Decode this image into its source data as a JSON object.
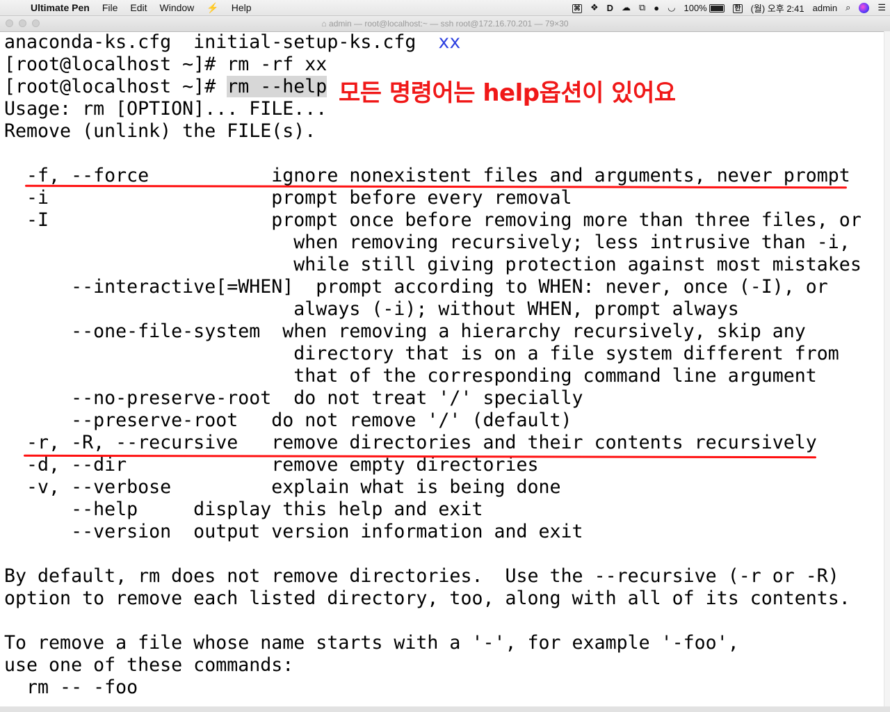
{
  "menubar": {
    "app_name": "Ultimate Pen",
    "items": [
      "File",
      "Edit",
      "Window",
      "Help"
    ],
    "battery": "100%",
    "input_method": "한",
    "clock": "(월) 오후 2:41",
    "user": "admin"
  },
  "window": {
    "title": "admin — root@localhost:~ — ssh root@172.16.70.201 — 79×30"
  },
  "terminal": {
    "line1_files": "anaconda-ks.cfg  initial-setup-ks.cfg  ",
    "line1_dir": "xx",
    "prompt": "[root@localhost ~]# ",
    "cmd1": "rm -rf xx",
    "cmd2": "rm --help",
    "lines": [
      "Usage: rm [OPTION]... FILE...",
      "Remove (unlink) the FILE(s).",
      "",
      "  -f, --force           ignore nonexistent files and arguments, never prompt",
      "  -i                    prompt before every removal",
      "  -I                    prompt once before removing more than three files, or",
      "                          when removing recursively; less intrusive than -i,",
      "                          while still giving protection against most mistakes",
      "      --interactive[=WHEN]  prompt according to WHEN: never, once (-I), or",
      "                          always (-i); without WHEN, prompt always",
      "      --one-file-system  when removing a hierarchy recursively, skip any",
      "                          directory that is on a file system different from",
      "                          that of the corresponding command line argument",
      "      --no-preserve-root  do not treat '/' specially",
      "      --preserve-root   do not remove '/' (default)",
      "  -r, -R, --recursive   remove directories and their contents recursively",
      "  -d, --dir             remove empty directories",
      "  -v, --verbose         explain what is being done",
      "      --help     display this help and exit",
      "      --version  output version information and exit",
      "",
      "By default, rm does not remove directories.  Use the --recursive (-r or -R)",
      "option to remove each listed directory, too, along with all of its contents.",
      "",
      "To remove a file whose name starts with a '-', for example '-foo',",
      "use one of these commands:",
      "  rm -- -foo"
    ]
  },
  "annotation": {
    "text": "모든 명령어는 help옵션이 있어요",
    "color": "#f01818"
  }
}
